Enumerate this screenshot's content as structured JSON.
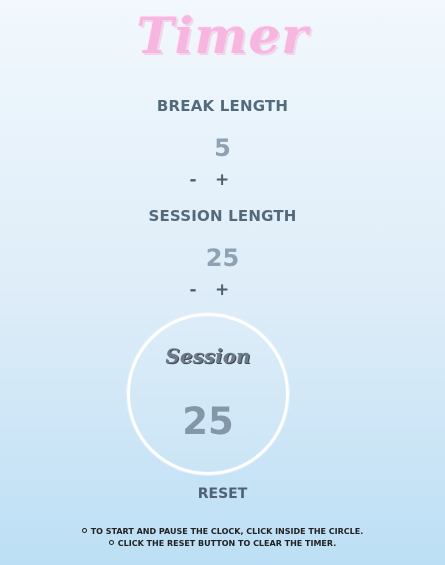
{
  "app": {
    "title": "Timer"
  },
  "break": {
    "label": "BREAK LENGTH",
    "value": "5",
    "decrement_label": "-",
    "increment_label": "+"
  },
  "session": {
    "label": "SESSION LENGTH",
    "value": "25",
    "decrement_label": "-",
    "increment_label": "+"
  },
  "timer": {
    "mode_label": "Session",
    "time": "25"
  },
  "reset": {
    "label": "RESET"
  },
  "instructions": [
    "TO START AND PAUSE THE CLOCK, CLICK INSIDE THE CIRCLE.",
    "CLICK THE RESET BUTTON TO CLEAR THE TIMER."
  ],
  "colors": {
    "title_pink": "#f6b6df",
    "label_text": "#536a7a",
    "value_text": "#8fa2b3",
    "circle_border": "#ffffff",
    "background_top": "#f2f8fd",
    "background_bottom": "#bcdff5"
  }
}
